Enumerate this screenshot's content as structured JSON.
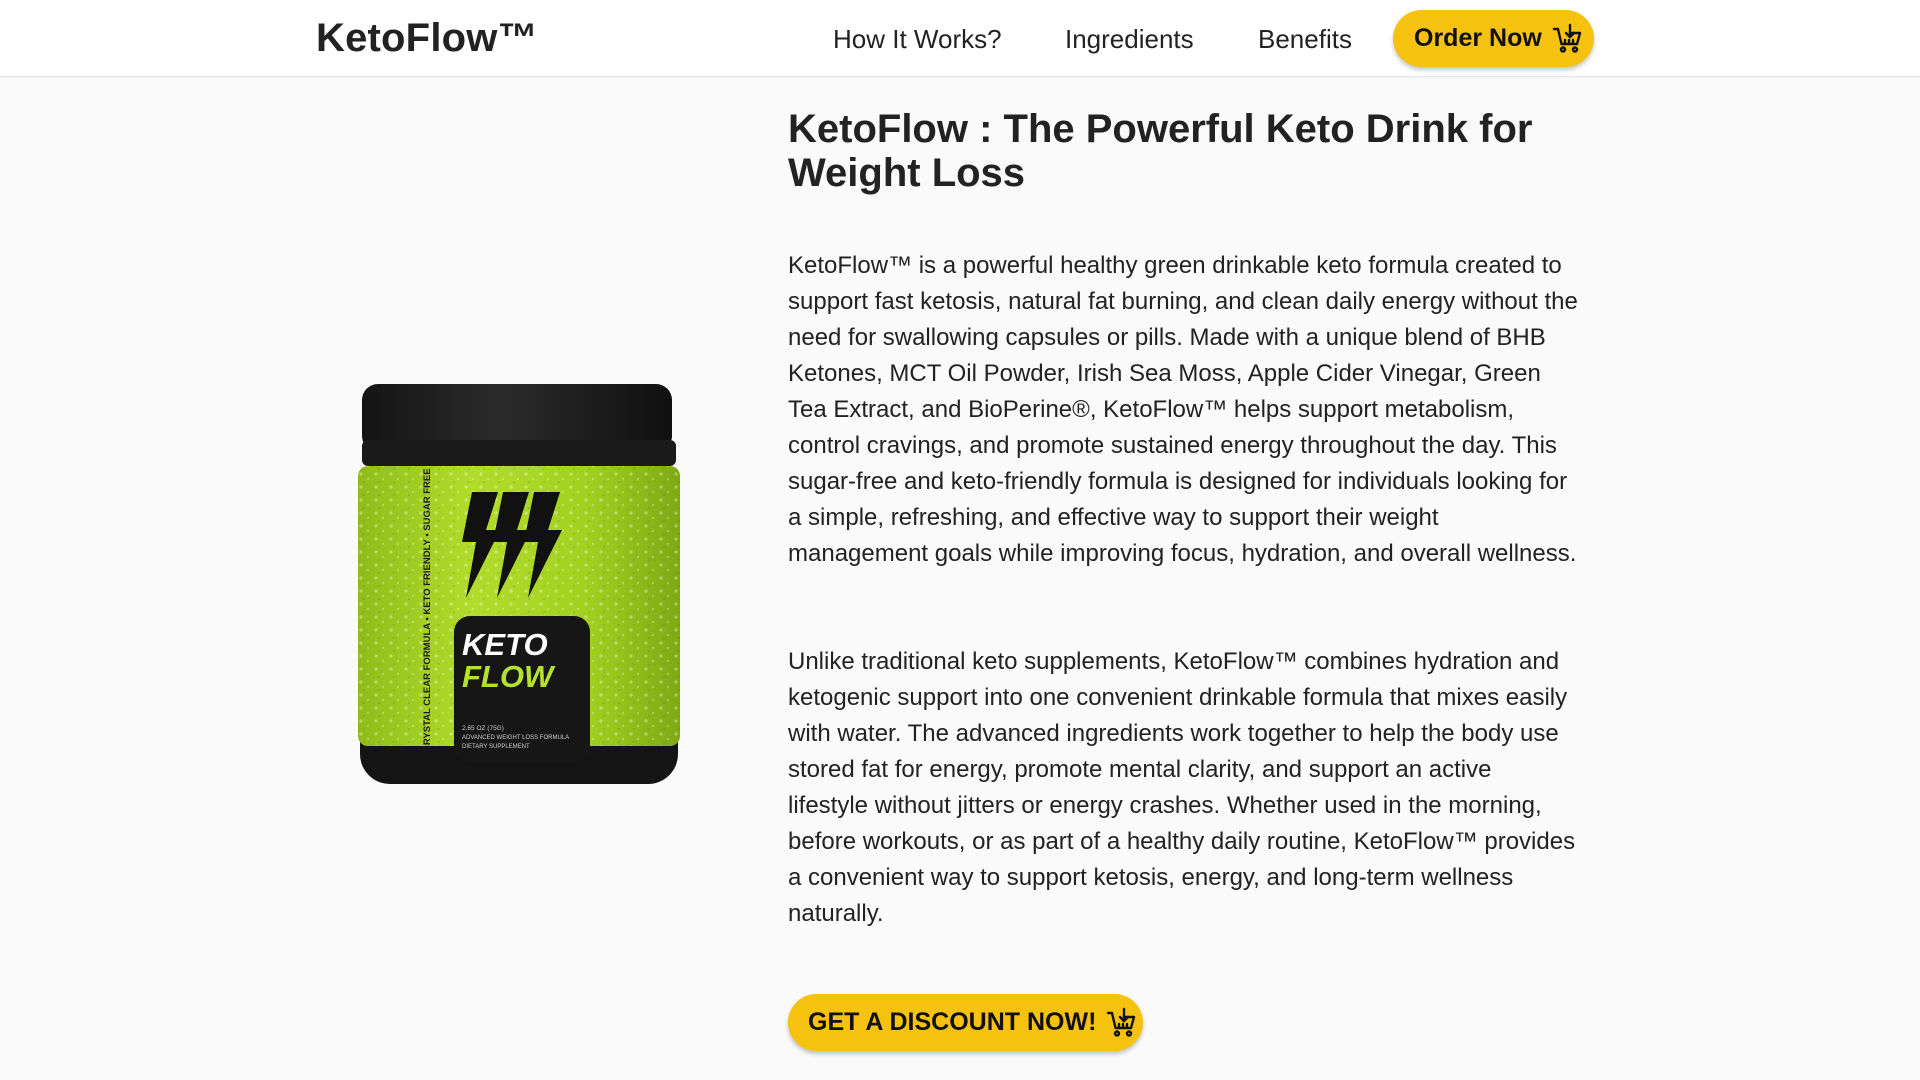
{
  "header": {
    "brand": "KetoFlow™",
    "nav": [
      {
        "label": "How It Works?"
      },
      {
        "label": "Ingredients"
      },
      {
        "label": "Benefits"
      }
    ],
    "order_button": "Order Now"
  },
  "product": {
    "jar_brand_line1": "KETO",
    "jar_brand_line2": "FLOW",
    "jar_side_text": "CRYSTAL CLEAR FORMULA • KETO FRIENDLY • SUGAR FREE",
    "jar_size": "2.65 OZ (75G)",
    "jar_desc": "ADVANCED WEIGHT LOSS FORMULA",
    "jar_type": "DIETARY SUPPLEMENT"
  },
  "main": {
    "title": "KetoFlow : The Powerful Keto Drink for Weight Loss",
    "paragraph1": "KetoFlow™ is a powerful healthy green drinkable keto formula created to support fast ketosis, natural fat burning, and clean daily energy without the need for swallowing capsules or pills. Made with a unique blend of BHB Ketones, MCT Oil Powder, Irish Sea Moss, Apple Cider Vinegar, Green Tea Extract, and BioPerine®, KetoFlow™ helps support metabolism, control cravings, and promote sustained energy throughout the day. This sugar-free and keto-friendly formula is designed for individuals looking for a simple, refreshing, and effective way to support their weight management goals while improving focus, hydration, and overall wellness.",
    "paragraph2": "Unlike traditional keto supplements, KetoFlow™ combines hydration and ketogenic support into one convenient drinkable formula that mixes easily with water. The advanced ingredients work together to help the body use stored fat for energy, promote mental clarity, and support an active lifestyle without jitters or energy crashes. Whether used in the morning, before workouts, or as part of a healthy daily routine, KetoFlow™ provides a convenient way to support ketosis, energy, and long-term wellness naturally.",
    "cta_button": "GET A DISCOUNT NOW!"
  },
  "colors": {
    "accent": "#f4c20f",
    "jar_green": "#a6d320",
    "jar_black": "#1c1c1c",
    "background": "#fafafa"
  },
  "icons": {
    "cart": "shopping-cart-download-icon",
    "lightning": "lightning-bolt-icon"
  }
}
